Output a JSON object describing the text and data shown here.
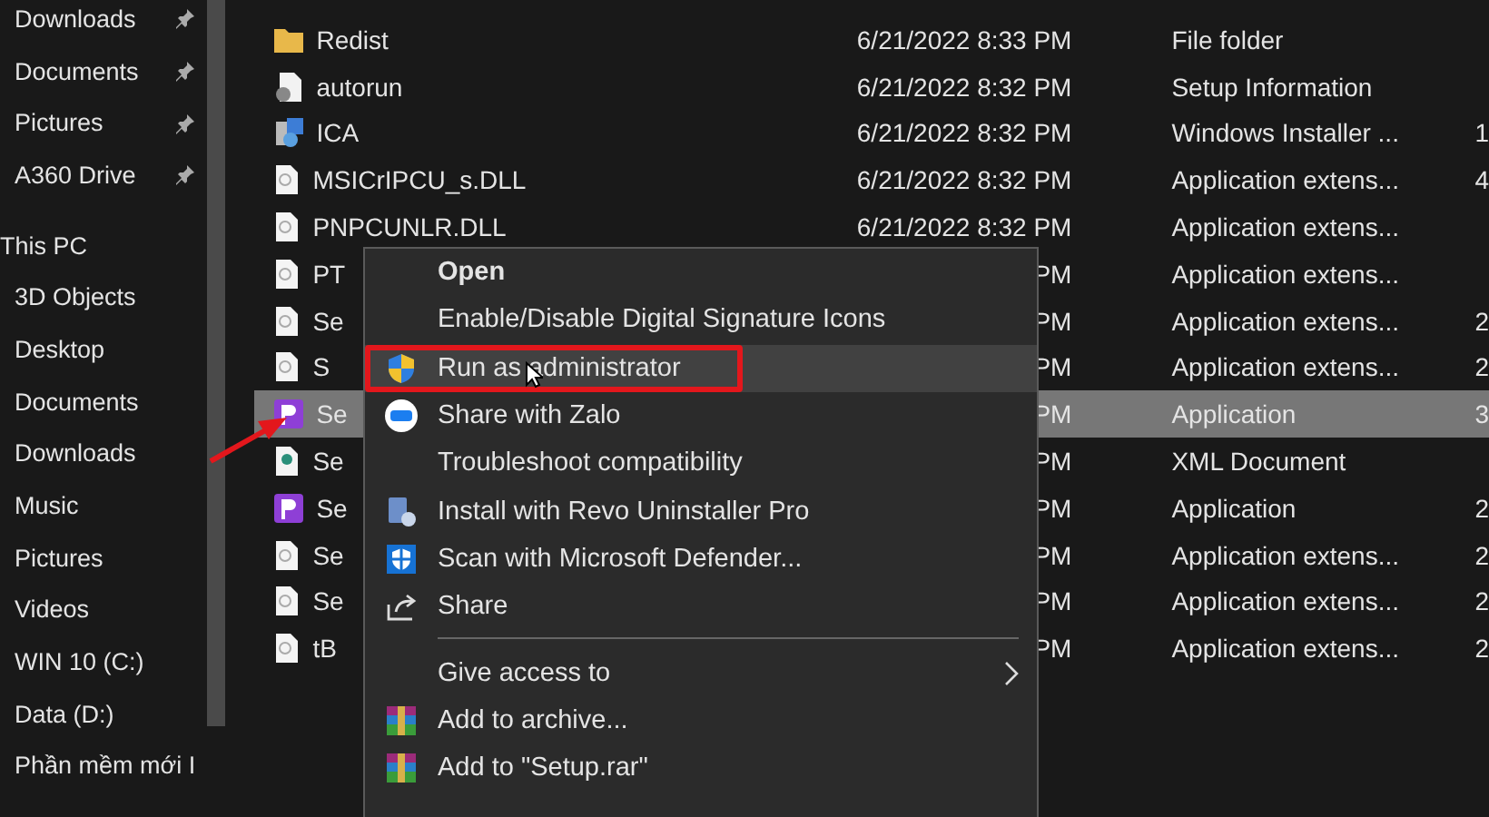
{
  "sidebar": {
    "items": [
      {
        "label": "Downloads",
        "kind": "pinned"
      },
      {
        "label": "Documents",
        "kind": "pinned"
      },
      {
        "label": "Pictures",
        "kind": "pinned"
      },
      {
        "label": "A360 Drive",
        "kind": "pinned"
      },
      {
        "label": "This PC",
        "kind": "header"
      },
      {
        "label": "3D Objects",
        "kind": "item"
      },
      {
        "label": "Desktop",
        "kind": "item"
      },
      {
        "label": "Documents",
        "kind": "item"
      },
      {
        "label": "Downloads",
        "kind": "item"
      },
      {
        "label": "Music",
        "kind": "item"
      },
      {
        "label": "Pictures",
        "kind": "item"
      },
      {
        "label": "Videos",
        "kind": "item"
      },
      {
        "label": "WIN 10 (C:)",
        "kind": "item"
      },
      {
        "label": "Data (D:)",
        "kind": "item"
      },
      {
        "label": "Phần mềm mới I",
        "kind": "item"
      }
    ]
  },
  "files": [
    {
      "name": "Redist",
      "kind": "folder",
      "date": "6/21/2022 8:33 PM",
      "type": "File folder",
      "selected": false
    },
    {
      "name": "autorun",
      "kind": "setup",
      "date": "6/21/2022 8:32 PM",
      "type": "Setup Information",
      "selected": false
    },
    {
      "name": "ICA",
      "kind": "installer",
      "date": "6/21/2022 8:32 PM",
      "type": "Windows Installer ...",
      "size": "1",
      "selected": false
    },
    {
      "name": "MSICrIPCU_s.DLL",
      "kind": "dll",
      "date": "6/21/2022 8:32 PM",
      "type": "Application extens...",
      "size": "4",
      "selected": false
    },
    {
      "name": "PNPCUNLR.DLL",
      "kind": "dll",
      "date": "6/21/2022 8:32 PM",
      "type": "Application extens...",
      "selected": false
    },
    {
      "name": "PT",
      "kind": "dll",
      "date": "PM",
      "type": "Application extens...",
      "selected": false
    },
    {
      "name": "Se",
      "kind": "dll",
      "date": "PM",
      "type": "Application extens...",
      "size": "2",
      "selected": false
    },
    {
      "name": "S",
      "kind": "dll",
      "date": "PM",
      "type": "Application extens...",
      "size": "2",
      "selected": false
    },
    {
      "name": "Se",
      "kind": "app",
      "date": "PM",
      "type": "Application",
      "size": "3",
      "selected": true
    },
    {
      "name": "Se",
      "kind": "xml",
      "date": "PM",
      "type": "XML Document",
      "selected": false
    },
    {
      "name": "Se",
      "kind": "app",
      "date": "PM",
      "type": "Application",
      "size": "2",
      "selected": false
    },
    {
      "name": "Se",
      "kind": "dll",
      "date": "PM",
      "type": "Application extens...",
      "size": "2",
      "selected": false
    },
    {
      "name": "Se",
      "kind": "dll",
      "date": "PM",
      "type": "Application extens...",
      "size": "2",
      "selected": false
    },
    {
      "name": "tB",
      "kind": "dll",
      "date": "PM",
      "type": "Application extens...",
      "size": "2",
      "selected": false
    }
  ],
  "context_menu": {
    "items": [
      {
        "label": "Open",
        "kind": "default",
        "selected": false
      },
      {
        "label": "Enable/Disable Digital Signature Icons",
        "kind": "plain",
        "selected": false
      },
      {
        "label": "Run as administrator",
        "kind": "shield",
        "selected": true
      },
      {
        "label": "Share with Zalo",
        "kind": "zalo",
        "selected": false
      },
      {
        "label": "Troubleshoot compatibility",
        "kind": "plain",
        "selected": false
      },
      {
        "label": "Install with Revo Uninstaller Pro",
        "kind": "revo",
        "selected": false
      },
      {
        "label": "Scan with Microsoft Defender...",
        "kind": "defender",
        "selected": false
      },
      {
        "label": "Share",
        "kind": "share",
        "selected": false
      },
      {
        "kind": "separator"
      },
      {
        "label": "Give access to",
        "kind": "submenu",
        "selected": false
      },
      {
        "label": "Add to archive...",
        "kind": "archive",
        "selected": false
      },
      {
        "label": "Add to \"Setup.rar\"",
        "kind": "archive",
        "selected": false
      }
    ]
  }
}
